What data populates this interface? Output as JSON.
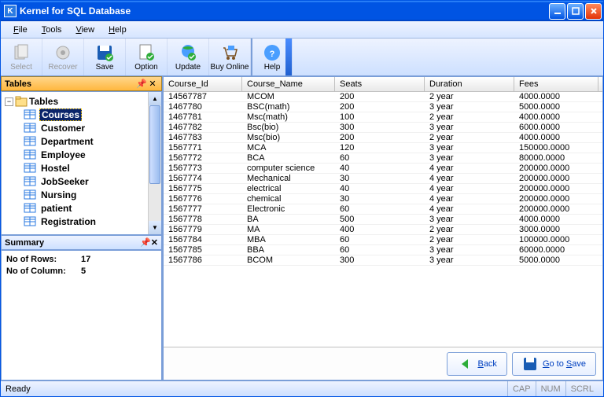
{
  "window": {
    "title": "Kernel for SQL Database",
    "icon_letter": "K"
  },
  "menu": [
    "File",
    "Tools",
    "View",
    "Help"
  ],
  "toolbar": [
    {
      "id": "select",
      "label": "Select",
      "disabled": true
    },
    {
      "id": "recover",
      "label": "Recover",
      "disabled": true
    },
    {
      "id": "save",
      "label": "Save",
      "disabled": false
    },
    {
      "id": "option",
      "label": "Option",
      "disabled": false
    },
    {
      "id": "update",
      "label": "Update",
      "disabled": false
    },
    {
      "id": "buyonline",
      "label": "Buy Online",
      "disabled": false
    },
    {
      "id": "help",
      "label": "Help",
      "disabled": false
    }
  ],
  "panels": {
    "tables_title": "Tables",
    "summary_title": "Summary"
  },
  "tree": {
    "root": "Tables",
    "items": [
      "Courses",
      "Customer",
      "Department",
      "Employee",
      "Hostel",
      "JobSeeker",
      "Nursing",
      "patient",
      "Registration"
    ],
    "selected": 0
  },
  "summary": {
    "rows_label": "No of Rows:",
    "rows_value": "17",
    "cols_label": "No of Column:",
    "cols_value": "5"
  },
  "grid": {
    "columns": [
      "Course_Id",
      "Course_Name",
      "Seats",
      "Duration",
      "Fees"
    ],
    "rows": [
      [
        "14567787",
        "MCOM",
        "200",
        "2 year",
        "4000.0000"
      ],
      [
        "1467780",
        "BSC(math)",
        "200",
        "3 year",
        "5000.0000"
      ],
      [
        "1467781",
        "Msc(math)",
        "100",
        "2 year",
        "4000.0000"
      ],
      [
        "1467782",
        "Bsc(bio)",
        "300",
        "3 year",
        "6000.0000"
      ],
      [
        "1467783",
        "Msc(bio)",
        "200",
        "2 year",
        "4000.0000"
      ],
      [
        "1567771",
        "MCA",
        "120",
        "3 year",
        "150000.0000"
      ],
      [
        "1567772",
        "BCA",
        "60",
        "3 year",
        "80000.0000"
      ],
      [
        "1567773",
        "computer science",
        "40",
        "4 year",
        "200000.0000"
      ],
      [
        "1567774",
        "Mechanical",
        "30",
        "4 year",
        "200000.0000"
      ],
      [
        "1567775",
        "electrical",
        "40",
        "4 year",
        "200000.0000"
      ],
      [
        "1567776",
        "chemical",
        "30",
        "4 year",
        "200000.0000"
      ],
      [
        "1567777",
        "Electronic",
        "60",
        "4 year",
        "200000.0000"
      ],
      [
        "1567778",
        "BA",
        "500",
        "3 year",
        "4000.0000"
      ],
      [
        "1567779",
        "MA",
        "400",
        "2 year",
        "3000.0000"
      ],
      [
        "1567784",
        "MBA",
        "60",
        "2 year",
        "100000.0000"
      ],
      [
        "1567785",
        "BBA",
        "60",
        "3 year",
        "60000.0000"
      ],
      [
        "1567786",
        "BCOM",
        "300",
        "3 year",
        "5000.0000"
      ]
    ]
  },
  "buttons": {
    "back": "Back",
    "save": "Go to Save"
  },
  "status": {
    "ready": "Ready",
    "cap": "CAP",
    "num": "NUM",
    "scrl": "SCRL"
  }
}
